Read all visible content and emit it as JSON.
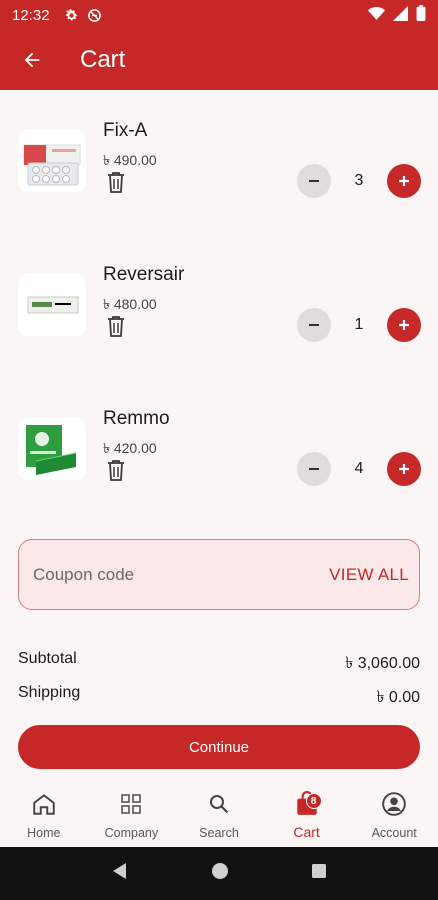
{
  "status": {
    "time": "12:32"
  },
  "appbar": {
    "title": "Cart"
  },
  "cart": {
    "items": [
      {
        "name": "Fix-A",
        "price": "৳ 490.00",
        "qty": "3"
      },
      {
        "name": "Reversair",
        "price": "৳ 480.00",
        "qty": "1"
      },
      {
        "name": "Remmo",
        "price": "৳ 420.00",
        "qty": "4"
      }
    ]
  },
  "coupon": {
    "placeholder": "Coupon code",
    "view_all": "VIEW ALL"
  },
  "summary": {
    "subtotal_label": "Subtotal",
    "subtotal_value": "৳ 3,060.00",
    "shipping_label": "Shipping",
    "shipping_value": "৳ 0.00"
  },
  "continue_label": "Continue",
  "nav": {
    "items": [
      {
        "label": "Home",
        "icon": "home-icon"
      },
      {
        "label": "Company",
        "icon": "grid-icon"
      },
      {
        "label": "Search",
        "icon": "search-icon"
      },
      {
        "label": "Cart",
        "icon": "cart-bag-icon",
        "badge": "8",
        "active": true
      },
      {
        "label": "Account",
        "icon": "account-icon"
      }
    ]
  },
  "colors": {
    "brand": "#c62828",
    "background": "#fbf5f5",
    "coupon_bg": "#fbe9e9"
  }
}
